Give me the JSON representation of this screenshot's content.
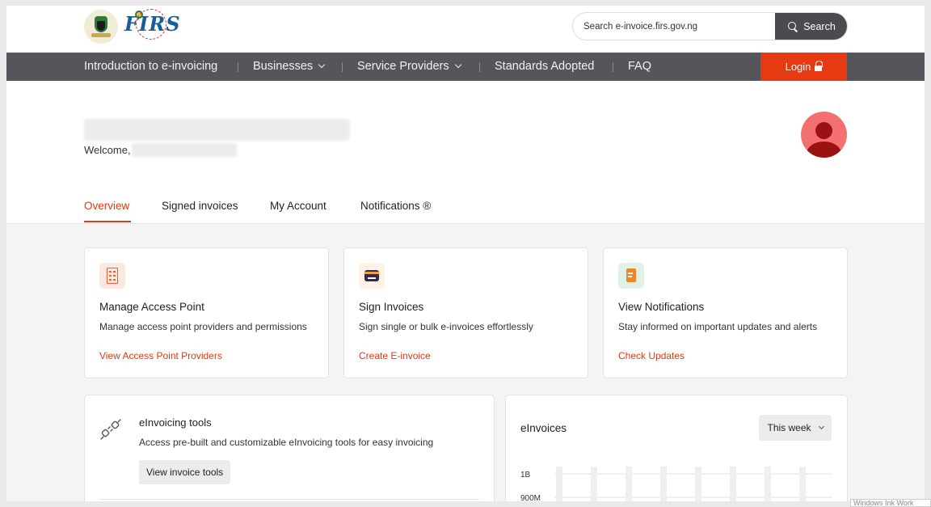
{
  "header": {
    "logo_text": "FIRS",
    "search_placeholder": "Search e-invoice.firs.gov.ng",
    "search_button": "Search"
  },
  "nav": {
    "items": [
      "Introduction to e-invoicing",
      "Businesses",
      "Service Providers",
      "Standards Adopted",
      "FAQ"
    ],
    "login": "Login"
  },
  "profile": {
    "welcome": "Welcome,"
  },
  "tabs": [
    "Overview",
    "Signed invoices",
    "My Account",
    "Notifications ®"
  ],
  "cards": [
    {
      "icon": "building-icon",
      "title": "Manage Access Point",
      "desc": "Manage access point providers and permissions",
      "link": "View Access Point Providers"
    },
    {
      "icon": "card-icon",
      "title": "Sign Invoices",
      "desc": "Sign single or bulk e-invoices effortlessly",
      "link": "Create E-invoice"
    },
    {
      "icon": "notification-icon",
      "title": "View Notifications",
      "desc": "Stay informed on important updates and alerts",
      "link": "Check Updates"
    }
  ],
  "tools": {
    "icon": "plug-icon",
    "title": "eInvoicing tools",
    "desc": "Access pre-built and customizable eInvoicing tools for easy invoicing",
    "button": "View invoice tools"
  },
  "chart": {
    "title": "eInvoices",
    "period": "This week"
  },
  "chart_data": {
    "type": "bar",
    "title": "eInvoices",
    "categories": [
      "",
      "",
      "",
      "",
      "",
      "",
      "",
      ""
    ],
    "values": [
      null,
      null,
      null,
      null,
      null,
      null,
      null,
      null
    ],
    "ytick_labels": [
      "1B",
      "900M"
    ],
    "yticks": [
      1000000000,
      900000000
    ],
    "ylim": [
      0,
      1000000000
    ],
    "grid": true
  },
  "footer": {
    "watermark": "Windows Ink Work"
  }
}
